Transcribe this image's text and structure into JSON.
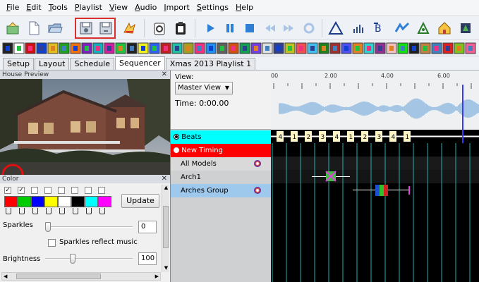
{
  "menu": [
    "File",
    "Edit",
    "Tools",
    "Playlist",
    "View",
    "Audio",
    "Import",
    "Settings",
    "Help"
  ],
  "tabs": [
    {
      "label": "Setup",
      "active": false
    },
    {
      "label": "Layout",
      "active": false
    },
    {
      "label": "Schedule",
      "active": false
    },
    {
      "label": "Sequencer",
      "active": true
    },
    {
      "label": "Xmas 2013 Playlist 1",
      "active": false
    }
  ],
  "house_preview": {
    "title": "House Preview"
  },
  "color_panel": {
    "title": "Color",
    "update_label": "Update",
    "palette": [
      "#ff0000",
      "#00cc00",
      "#0000ff",
      "#ffff00",
      "#ffffff",
      "#000000",
      "#00ffff",
      "#ff00ff"
    ],
    "checks": [
      true,
      true,
      false,
      false,
      false,
      false,
      false,
      false
    ],
    "sparkles_label": "Sparkles",
    "sparkles_value": "0",
    "sparkles_level": 0.0,
    "sparkles_music_label": "Sparkles reflect music",
    "brightness_label": "Brightness",
    "brightness_value": "100",
    "brightness_level": 0.3
  },
  "view_panel": {
    "view_label": "View:",
    "view_select": "Master View",
    "time_label": "Time: 0:00.00"
  },
  "rows": {
    "beats": "Beats",
    "new_timing": "New Timing",
    "all_models": "All Models",
    "arch1": "Arch1",
    "arches_group": "Arches Group"
  },
  "ruler_labels": [
    "00",
    "2.00",
    "4.00",
    "6.00"
  ],
  "beat_labels": [
    "4",
    "1",
    "2",
    "3",
    "4",
    "1",
    "2",
    "3",
    "4",
    "1"
  ],
  "colors": {
    "beats_row": "#00ffff",
    "new_timing_row": "#ff0000",
    "selected_row": "#9ec8ec",
    "gridline": "#20b0b0",
    "playhead": "#3a3aff",
    "wave": "#5b9bd5"
  }
}
